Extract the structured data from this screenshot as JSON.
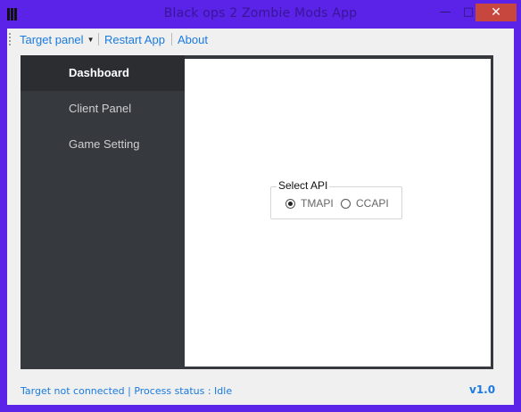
{
  "window": {
    "title": "Black ops 2 Zombie Mods App",
    "minimize_label": "—",
    "maximize_label": "□",
    "close_label": "✕",
    "icon": "app-logo-icon"
  },
  "menubar": {
    "items": [
      {
        "label": "Target panel",
        "has_dropdown": true
      },
      {
        "label": "Restart App"
      },
      {
        "label": "About"
      }
    ],
    "dropdown_caret": "▼"
  },
  "sidebar": {
    "items": [
      {
        "label": "Dashboard",
        "active": true
      },
      {
        "label": "Client Panel"
      },
      {
        "label": "Game Setting"
      }
    ]
  },
  "main": {
    "api_group": {
      "label": "Select API",
      "options": [
        {
          "label": "TMAPI",
          "checked": true
        },
        {
          "label": "CCAPI",
          "checked": false
        }
      ]
    }
  },
  "status": {
    "text": "Target not connected | Process status : Idle",
    "version": "v1.0"
  },
  "colors": {
    "window_frame": "#5b22e8",
    "accent_link": "#1a7ae0",
    "sidebar_bg": "#36393e",
    "sidebar_active": "#2b2d31",
    "close_button": "#c7473f"
  }
}
